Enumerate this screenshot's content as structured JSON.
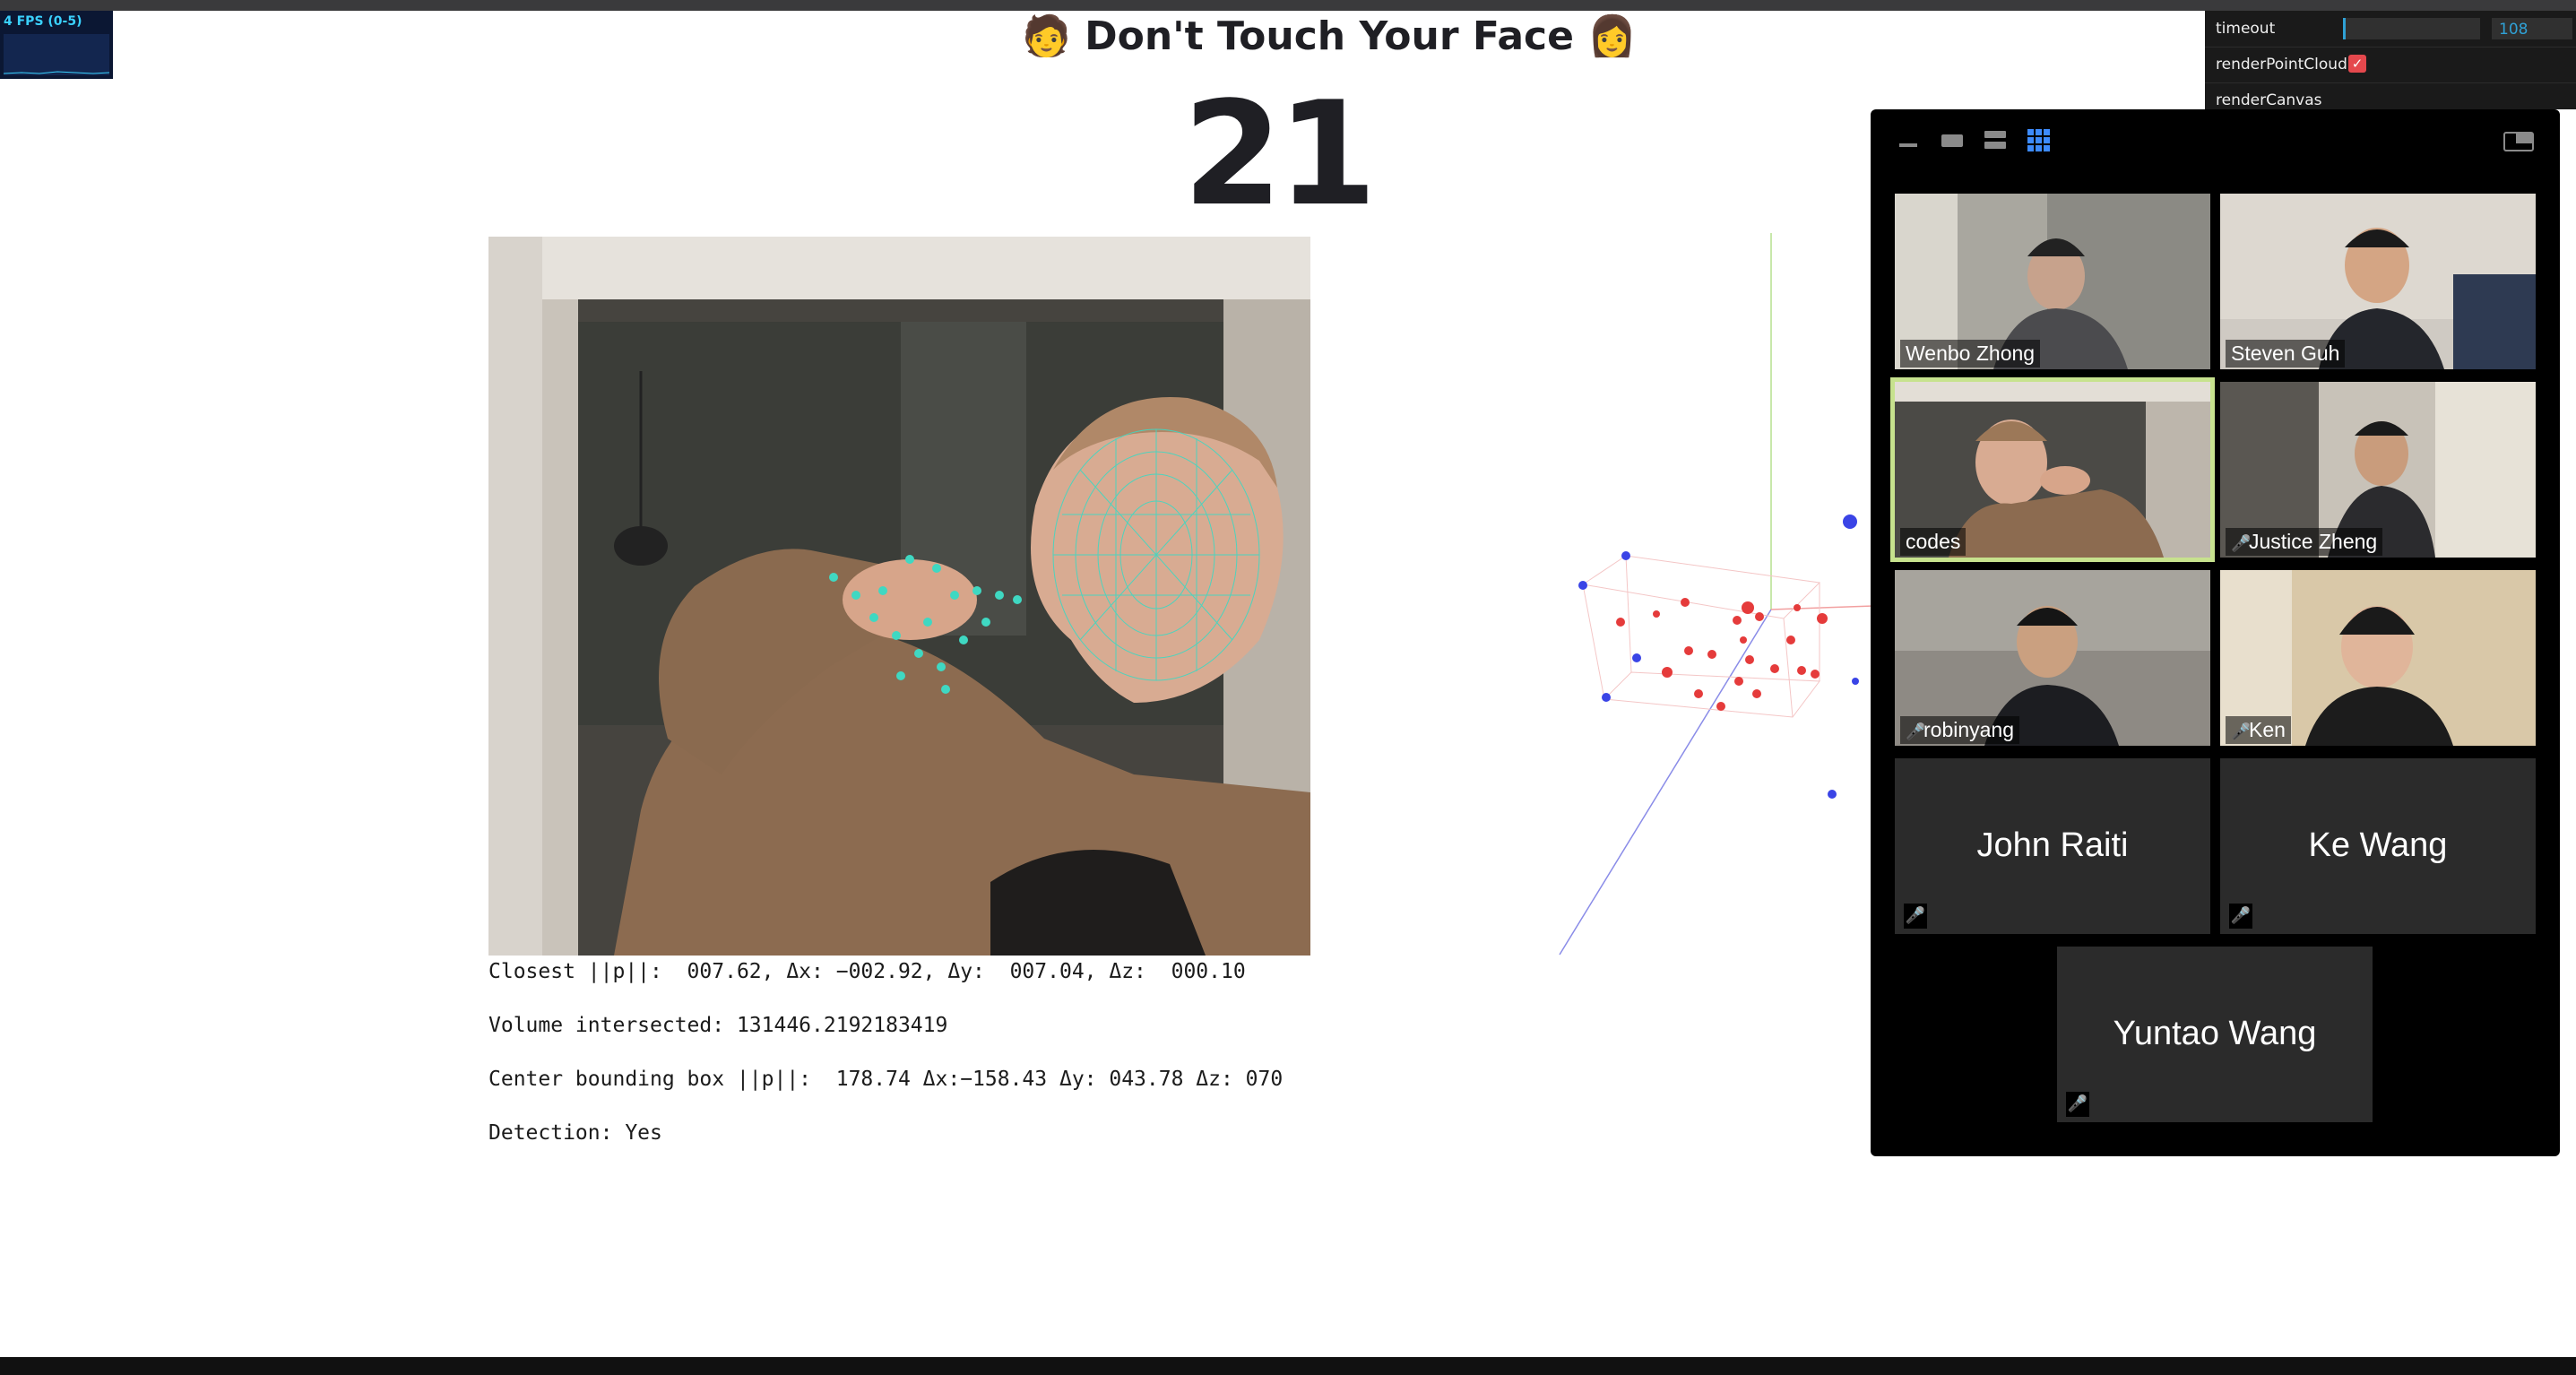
{
  "fps": {
    "label": "4 FPS (0-5)"
  },
  "header": {
    "title": "🧑 Don't Touch Your Face 👩",
    "counter": "21"
  },
  "stats": {
    "closest": "Closest ||p||:  007.62, Δx: −002.92, Δy:  007.04, Δz:  000.10",
    "volume": "Volume intersected: 131446.2192183419",
    "center": "Center bounding box ||p||:  178.74 Δx:−158.43 Δy: 043.78 Δz: 070",
    "detection": "Detection: Yes"
  },
  "gui": {
    "timeout_label": "timeout",
    "timeout_value": "108",
    "render_point_cloud_label": "renderPointCloud",
    "render_canvas_label": "renderCanvas",
    "check_mark": "✓"
  },
  "zoom": {
    "accent_color": "#c7e28e",
    "participants": [
      {
        "name": "Wenbo Zhong",
        "muted": false
      },
      {
        "name": "Steven Guh",
        "muted": false
      },
      {
        "name": "codes",
        "muted": false,
        "speaking": true
      },
      {
        "name": "Justice Zheng",
        "muted": true
      },
      {
        "name": "robinyang",
        "muted": true
      },
      {
        "name": "Ken",
        "muted": true
      },
      {
        "name": "John Raiti",
        "muted": true,
        "video": false
      },
      {
        "name": "Ke Wang",
        "muted": true,
        "video": false
      },
      {
        "name": "Yuntao Wang",
        "muted": true,
        "video": false
      }
    ],
    "mute_icon": "🎤"
  }
}
